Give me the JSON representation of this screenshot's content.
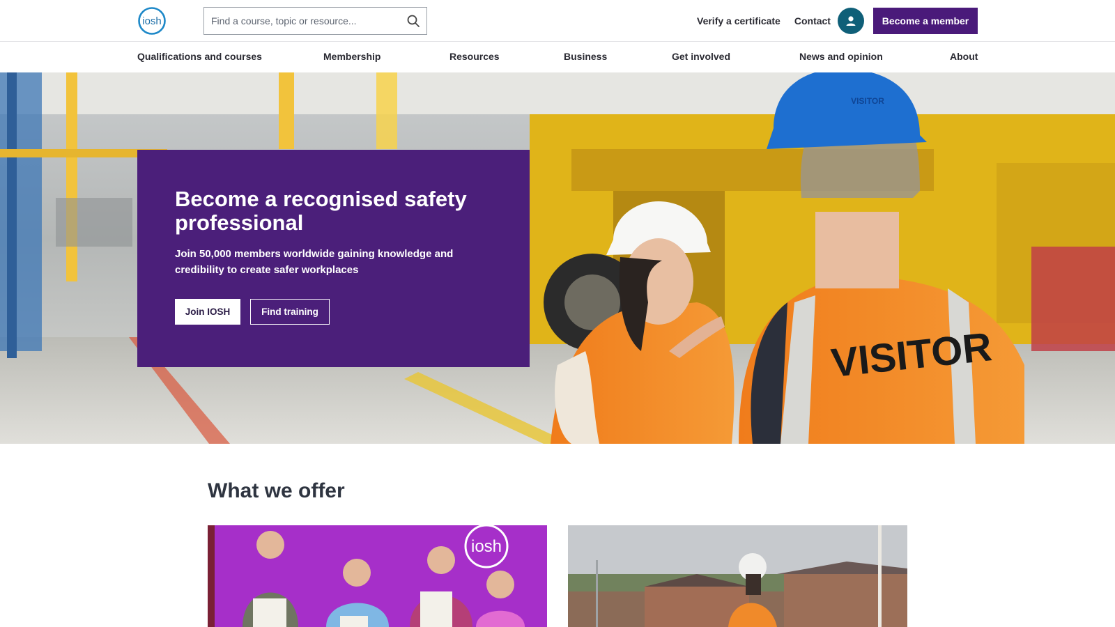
{
  "header": {
    "logo_text": "iosh",
    "search": {
      "placeholder": "Find a course, topic or resource..."
    },
    "links": [
      {
        "label": "Verify a certificate"
      },
      {
        "label": "Contact"
      }
    ],
    "cta_label": "Become a member",
    "colors": {
      "brand_purple": "#4a1a7a",
      "account_teal": "#0f5f78",
      "logo_blue": "#1d88c8"
    }
  },
  "nav": {
    "items": [
      {
        "label": "Qualifications and courses"
      },
      {
        "label": "Membership"
      },
      {
        "label": "Resources"
      },
      {
        "label": "Business"
      },
      {
        "label": "Get involved"
      },
      {
        "label": "News and opinion"
      },
      {
        "label": "About"
      }
    ]
  },
  "hero": {
    "title": "Become a recognised safety professional",
    "text": "Join 50,000 members worldwide gaining knowledge and credibility to create safer workplaces",
    "primary_button": "Join IOSH",
    "secondary_button": "Find training",
    "vest_text": "VISITOR",
    "helmet_text": "VISITOR"
  },
  "offer": {
    "title": "What we offer",
    "cards": [
      {
        "banner_text": "iosh"
      },
      {
        "banner_text": ""
      }
    ]
  }
}
